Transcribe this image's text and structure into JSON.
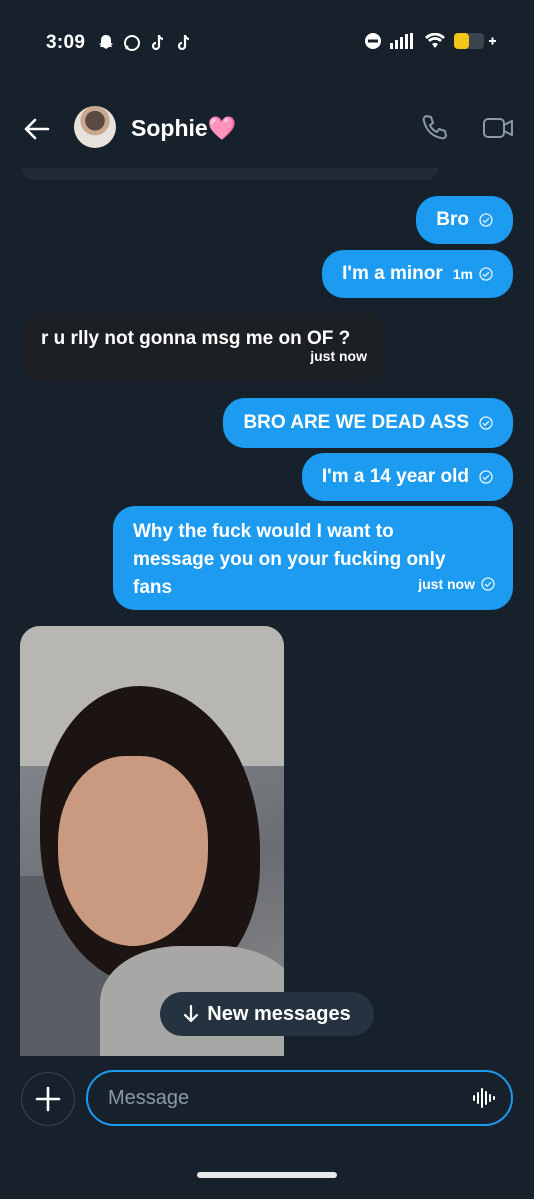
{
  "status_bar": {
    "time": "3:09",
    "left_icons": [
      "snapchat-icon",
      "chat-bubble-icon",
      "tiktok-icon",
      "tiktok-icon"
    ],
    "right_icons": [
      "do-not-disturb-icon",
      "signal-icon",
      "wifi-icon",
      "battery-icon"
    ],
    "battery_level": 0.5
  },
  "header": {
    "contact_name": "Sophie🩷",
    "icons": [
      "back-arrow-icon",
      "phone-icon",
      "video-camera-icon"
    ]
  },
  "messages": [
    {
      "direction": "outgoing",
      "text": "Bro",
      "time": ""
    },
    {
      "direction": "outgoing",
      "text": "I'm a minor",
      "time": "1m"
    },
    {
      "direction": "incoming",
      "text": "r u rlly not gonna msg me on OF ?",
      "time": "just now"
    },
    {
      "direction": "outgoing",
      "text": "BRO ARE WE DEAD ASS",
      "time": ""
    },
    {
      "direction": "outgoing",
      "text": "I'm a 14 year old",
      "time": ""
    },
    {
      "direction": "outgoing",
      "text": "Why the fuck would I want to message you on your fucking only fans",
      "time": "just now"
    }
  ],
  "new_messages_label": "New messages",
  "composer": {
    "placeholder": "Message"
  },
  "colors": {
    "background": "#17212b",
    "outgoing_bubble": "#1d9bf0",
    "incoming_bubble": "#1c1f24",
    "accent": "#1d9bf0"
  }
}
